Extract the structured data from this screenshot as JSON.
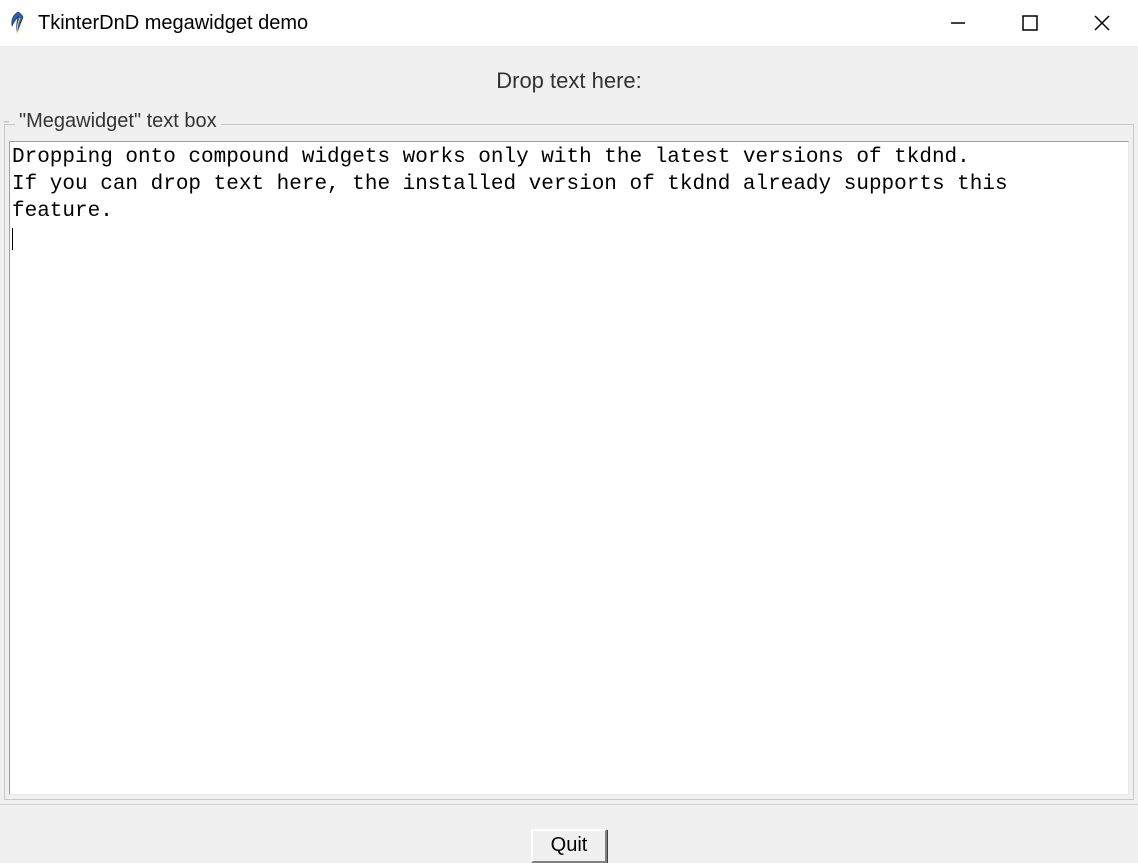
{
  "window": {
    "title": "TkinterDnD megawidget demo",
    "icon": "tk-feather-icon"
  },
  "controls": {
    "minimize": "minimize-icon",
    "maximize": "maximize-icon",
    "close": "close-icon"
  },
  "header": {
    "label": "Drop text here:"
  },
  "labelframe": {
    "legend": "\"Megawidget\" text box"
  },
  "textbox": {
    "content": "Dropping onto compound widgets works only with the latest versions of tkdnd.\nIf you can drop text here, the installed version of tkdnd already supports this\nfeature.\n"
  },
  "buttons": {
    "quit": "Quit"
  }
}
